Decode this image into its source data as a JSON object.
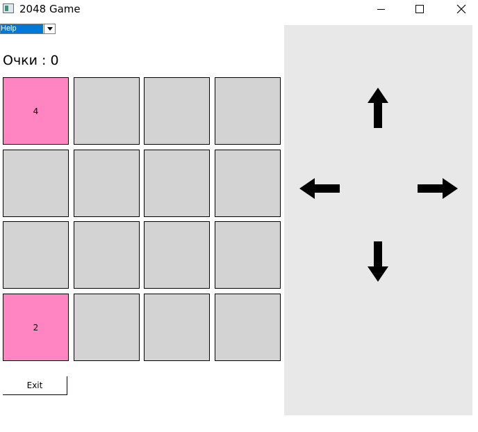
{
  "window": {
    "title": "2048 Game"
  },
  "menu": {
    "help_label": "Help"
  },
  "score": {
    "label": "Очки : 0"
  },
  "board": {
    "rows": [
      [
        {
          "value": "4",
          "color": "#ff85c2"
        },
        {
          "value": "",
          "color": "#d3d3d3"
        },
        {
          "value": "",
          "color": "#d3d3d3"
        },
        {
          "value": "",
          "color": "#d3d3d3"
        }
      ],
      [
        {
          "value": "",
          "color": "#d3d3d3"
        },
        {
          "value": "",
          "color": "#d3d3d3"
        },
        {
          "value": "",
          "color": "#d3d3d3"
        },
        {
          "value": "",
          "color": "#d3d3d3"
        }
      ],
      [
        {
          "value": "",
          "color": "#d3d3d3"
        },
        {
          "value": "",
          "color": "#d3d3d3"
        },
        {
          "value": "",
          "color": "#d3d3d3"
        },
        {
          "value": "",
          "color": "#d3d3d3"
        }
      ],
      [
        {
          "value": "2",
          "color": "#ff85c2"
        },
        {
          "value": "",
          "color": "#d3d3d3"
        },
        {
          "value": "",
          "color": "#d3d3d3"
        },
        {
          "value": "",
          "color": "#d3d3d3"
        }
      ]
    ]
  },
  "exit": {
    "label": "Exit"
  },
  "controls": {
    "up": "arrow-up-icon",
    "down": "arrow-down-icon",
    "left": "arrow-left-icon",
    "right": "arrow-right-icon"
  }
}
